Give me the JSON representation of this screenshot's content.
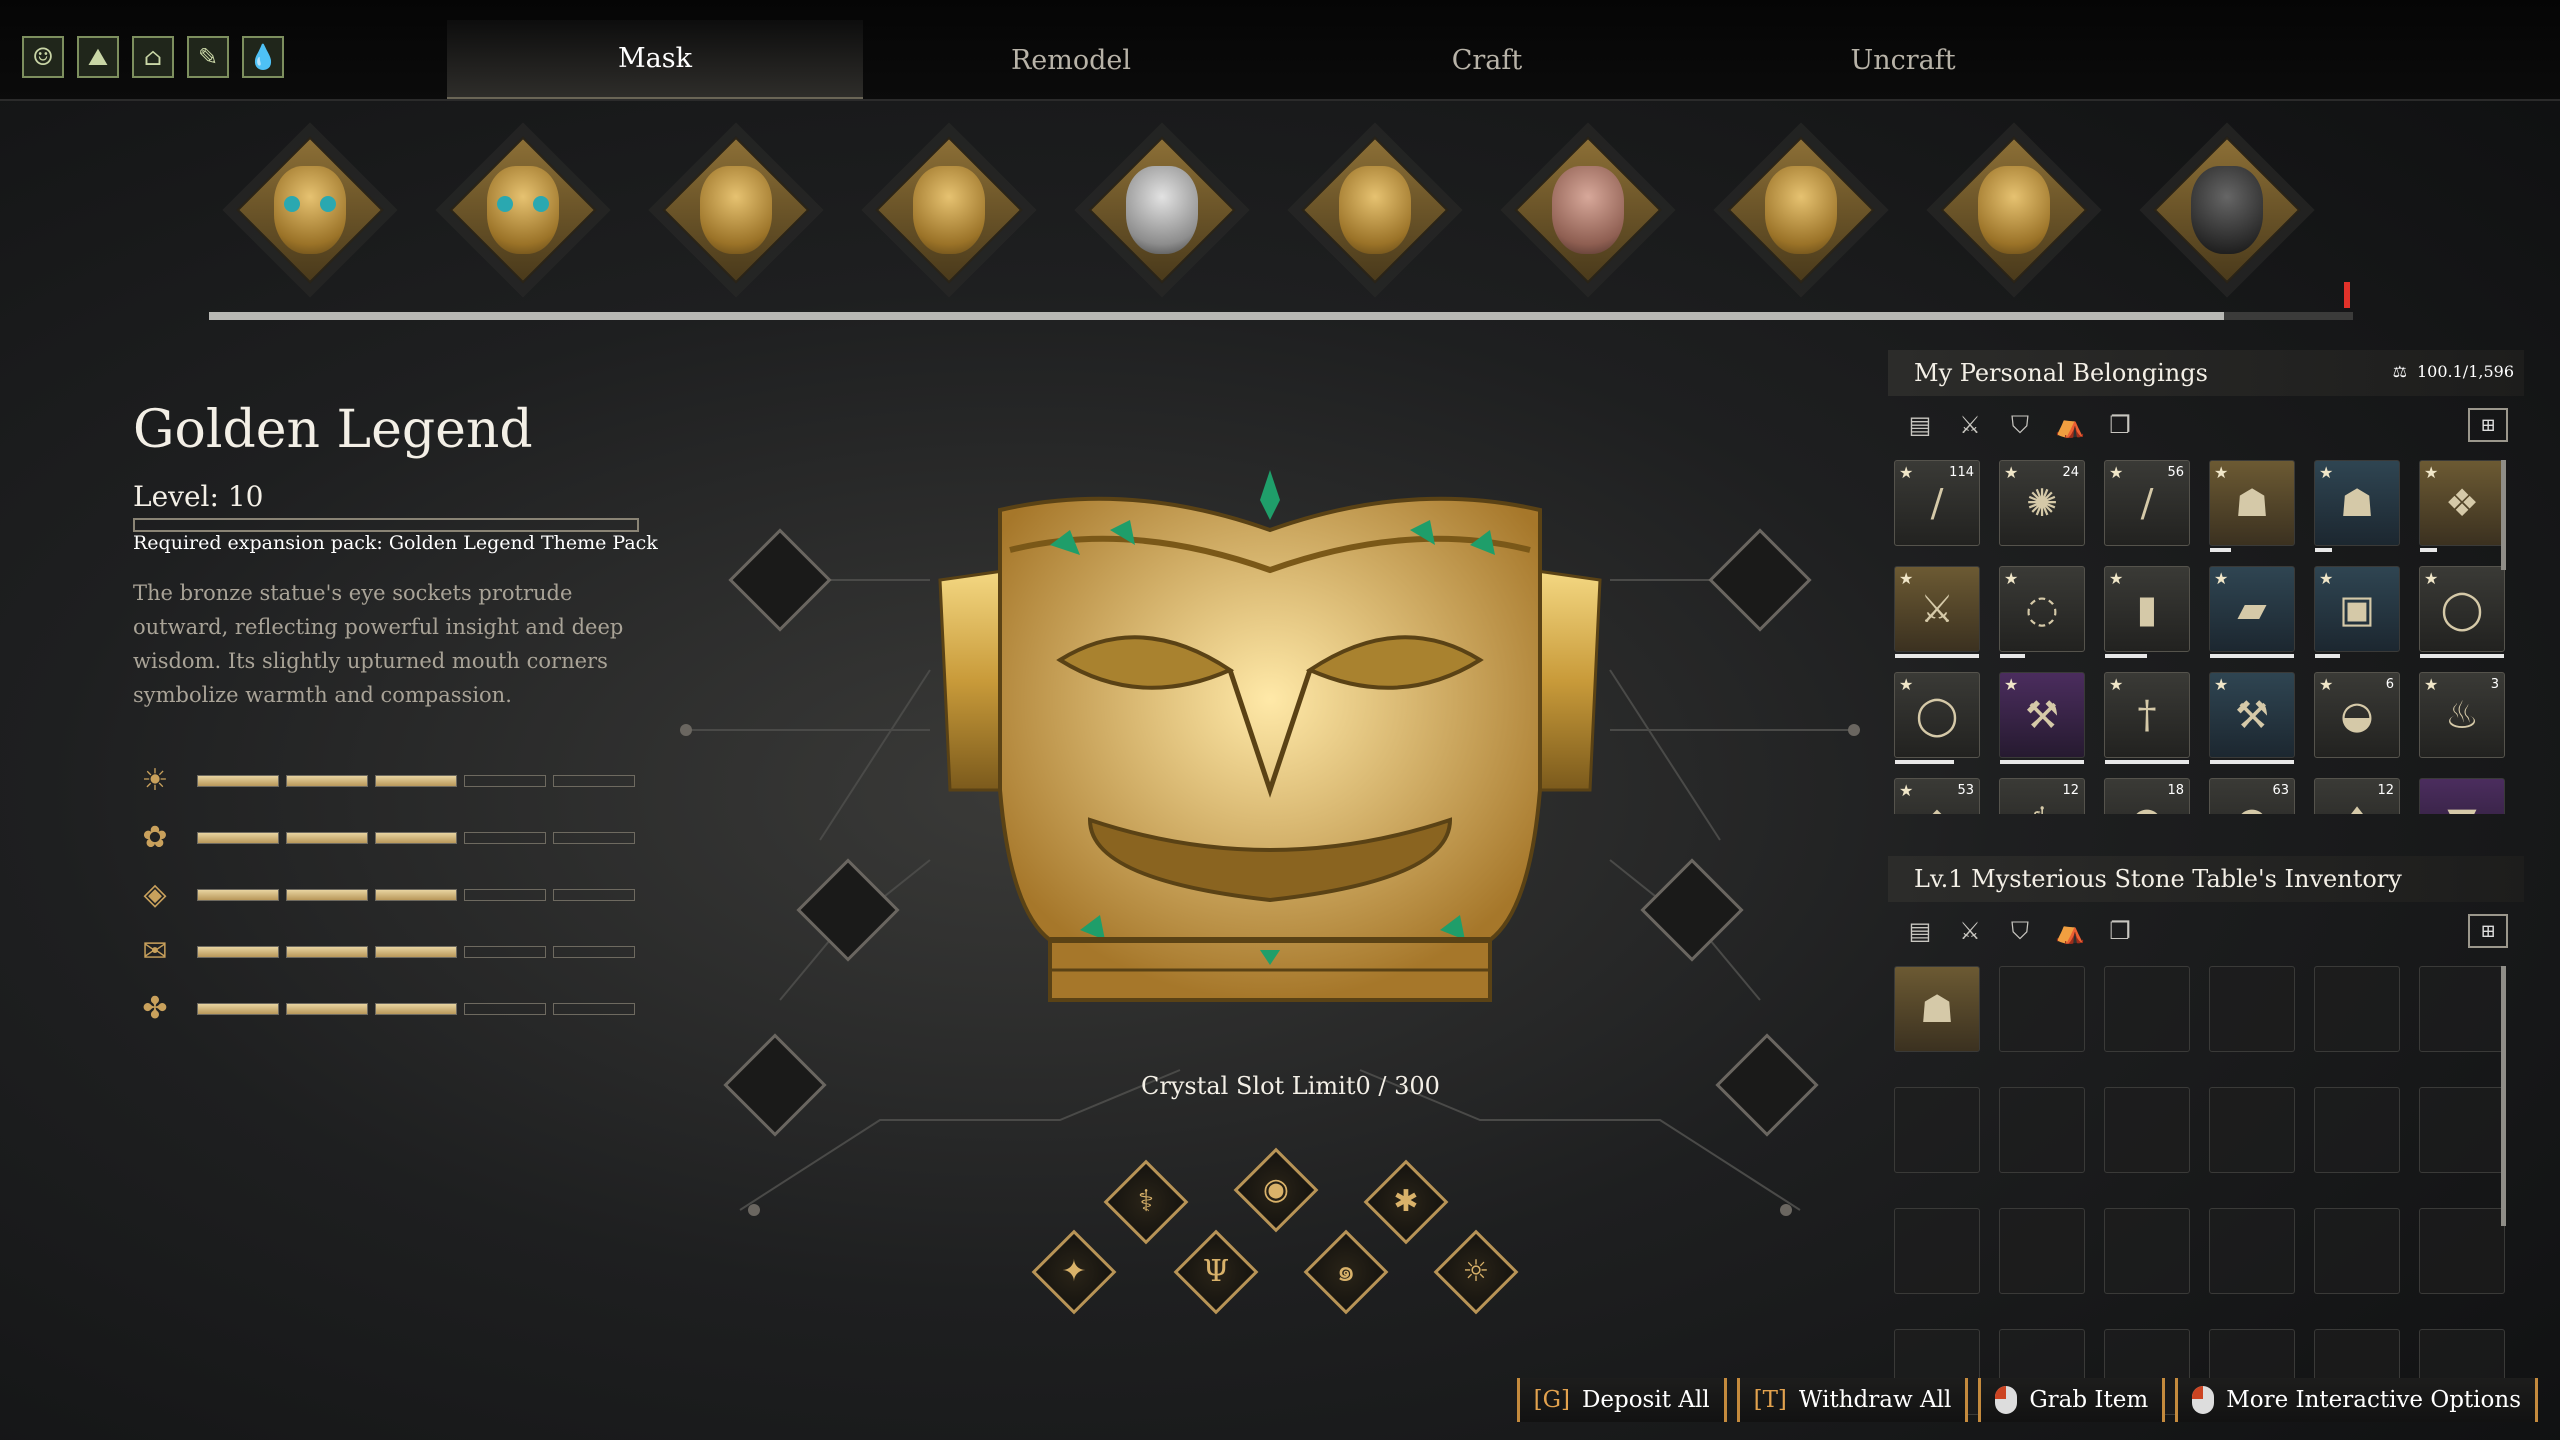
{
  "quick_icons": [
    "character-icon",
    "map-icon",
    "camp-icon",
    "craft-icon",
    "water-icon"
  ],
  "tabs": [
    {
      "label": "Mask",
      "active": true
    },
    {
      "label": "Remodel",
      "active": false
    },
    {
      "label": "Craft",
      "active": false
    },
    {
      "label": "Uncraft",
      "active": false
    }
  ],
  "mask_carousel": {
    "count": 10,
    "scroll_progress": 0.94
  },
  "details": {
    "name": "Golden Legend",
    "level_text": "Level: 10",
    "requirement": "Required expansion pack: Golden Legend Theme Pack",
    "description": "The bronze statue's eye sockets protrude outward, reflecting powerful insight and deep wisdom. Its slightly upturned mouth corners symbolize warmth and compassion.",
    "stats": [
      {
        "icon": "sun-icon",
        "filled": 3,
        "total": 5
      },
      {
        "icon": "atom-icon",
        "filled": 3,
        "total": 5
      },
      {
        "icon": "gem-icon",
        "filled": 3,
        "total": 5
      },
      {
        "icon": "envelope-icon",
        "filled": 3,
        "total": 5
      },
      {
        "icon": "clover-icon",
        "filled": 3,
        "total": 5
      }
    ]
  },
  "crystal_slot": "Crystal Slot Limit0 / 300",
  "runes": [
    "scroll-rune-icon",
    "eye-rune-icon",
    "sparkle-rune-icon",
    "star-rune-icon",
    "trident-rune-icon",
    "spiral-rune-icon",
    "sun-rune-icon"
  ],
  "belongings": {
    "title": "My Personal Belongings",
    "weight": "100.1/1,596",
    "categories": [
      "resources-icon",
      "weapons-icon",
      "armor-icon",
      "camp-icon",
      "misc-icon"
    ],
    "items": [
      {
        "count": "114",
        "star": true,
        "style": "item",
        "glyph": "/"
      },
      {
        "count": "24",
        "star": true,
        "style": "item",
        "glyph": "✺"
      },
      {
        "count": "56",
        "star": true,
        "style": "item",
        "glyph": "/"
      },
      {
        "count": "",
        "star": true,
        "style": "gold",
        "glyph": "☗",
        "dur": 0.25
      },
      {
        "count": "",
        "star": true,
        "style": "blue",
        "glyph": "☗",
        "dur": 0.2
      },
      {
        "count": "",
        "star": true,
        "style": "gold",
        "glyph": "❖",
        "dur": 0.2
      },
      {
        "count": "",
        "star": true,
        "style": "gold",
        "glyph": "⚔",
        "dur": 1
      },
      {
        "count": "",
        "star": true,
        "style": "item",
        "glyph": "◌",
        "dur": 0.3
      },
      {
        "count": "",
        "star": true,
        "style": "item",
        "glyph": "▮",
        "dur": 0.5
      },
      {
        "count": "",
        "star": true,
        "style": "blue",
        "glyph": "▰",
        "dur": 1
      },
      {
        "count": "",
        "star": true,
        "style": "blue",
        "glyph": "▣",
        "dur": 0.3
      },
      {
        "count": "",
        "star": true,
        "style": "item",
        "glyph": "◯",
        "dur": 1
      },
      {
        "count": "",
        "star": true,
        "style": "item",
        "glyph": "◯",
        "dur": 0.7
      },
      {
        "count": "",
        "star": true,
        "style": "purple",
        "glyph": "⚒",
        "dur": 1
      },
      {
        "count": "",
        "star": true,
        "style": "item",
        "glyph": "†",
        "dur": 1
      },
      {
        "count": "",
        "star": true,
        "style": "blue",
        "glyph": "⚒",
        "dur": 1
      },
      {
        "count": "6",
        "star": true,
        "style": "item",
        "glyph": "◒"
      },
      {
        "count": "3",
        "star": true,
        "style": "item",
        "glyph": "♨"
      },
      {
        "count": "53",
        "star": true,
        "style": "item",
        "glyph": "◆"
      },
      {
        "count": "12",
        "star": false,
        "style": "item",
        "glyph": "⚕"
      },
      {
        "count": "18",
        "star": false,
        "style": "item",
        "glyph": "●"
      },
      {
        "count": "63",
        "star": false,
        "style": "item",
        "glyph": "●"
      },
      {
        "count": "12",
        "star": false,
        "style": "item",
        "glyph": "♦"
      },
      {
        "count": "",
        "star": false,
        "style": "purple",
        "glyph": "▼"
      }
    ]
  },
  "table_inventory": {
    "title": "Lv.1 Mysterious Stone Table's Inventory",
    "categories": [
      "resources-icon",
      "weapons-icon",
      "armor-icon",
      "camp-icon",
      "misc-icon"
    ],
    "slots": 24,
    "filled_slots": [
      0
    ]
  },
  "actions": [
    {
      "key": "[G]",
      "label": "Deposit All"
    },
    {
      "key": "[T]",
      "label": "Withdraw All"
    },
    {
      "key": "",
      "label": "Grab Item",
      "mouse": true
    },
    {
      "key": "",
      "label": "More Interactive Options",
      "mouse": true
    }
  ],
  "colors": {
    "accent": "#c48a3d",
    "gold": "#c9a15c",
    "emerald": "#1f9e6a"
  }
}
